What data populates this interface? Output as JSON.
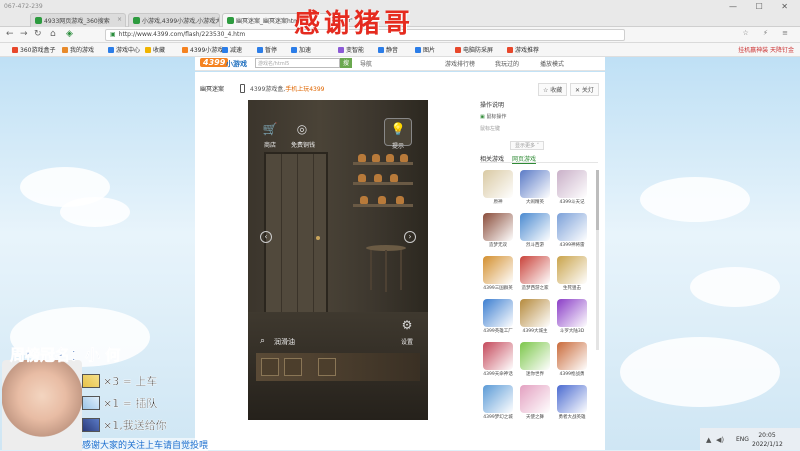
{
  "browser": {
    "ip_label": "067-472-239",
    "tabs": [
      {
        "title": "4933网页游戏_360搜索",
        "color": "#2d9b3f"
      },
      {
        "title": "小游戏,4399小游戏,小游戏大",
        "color": "#2d9b3f"
      },
      {
        "title": "幽冥迷案_幽冥迷案html5",
        "color": "#2d9b3f",
        "active": true
      }
    ],
    "new_tab": "+",
    "window_controls": "— ☐ ✕",
    "address": "http://www.4399.com/flash/223530_4.htm",
    "nav_right_icons": "☆ ⚡ ≡",
    "bookmarks": [
      {
        "label": "360游戏盒子",
        "color": "#e8472b"
      },
      {
        "label": "我的游戏",
        "color": "#e88a2b"
      },
      {
        "label": "游戏中心",
        "color": "#2b7de8"
      },
      {
        "label": "收藏",
        "color": "#f0b400"
      },
      {
        "label": "4399小游戏",
        "color": "#f58220"
      },
      {
        "label": "减速",
        "color": "#2b7de8"
      },
      {
        "label": "暂停",
        "color": "#2b7de8"
      },
      {
        "label": "加速",
        "color": "#2b7de8"
      },
      {
        "label": "变智能",
        "color": "#8c5ad6"
      },
      {
        "label": "静音",
        "color": "#2b7de8"
      },
      {
        "label": "图片",
        "color": "#2b7de8"
      },
      {
        "label": "电脑防采屏",
        "color": "#e8472b"
      },
      {
        "label": "游戏推荐",
        "color": "#e8472b"
      }
    ],
    "bookmark_right": "挂机赢神装 天降钉金"
  },
  "site": {
    "logo": "4399",
    "logo_suffix": "小游戏",
    "search_placeholder": "游戏名/html5",
    "search_button": "搜",
    "header_links": [
      "导航",
      "游戏排行榜",
      "我玩过的",
      "播放模式"
    ]
  },
  "game_page": {
    "title": "幽冥迷案",
    "note_prefix": "4399游戏盒,",
    "note_highlight": "手机上玩4399",
    "fav_button": "☆ 收藏",
    "close_button": "✕ 关灯"
  },
  "game": {
    "shop_label": "商店",
    "free_coins_label": "免费铜钱",
    "hint_label": "提示",
    "settings_label": "设置",
    "item_name": "润滑油",
    "left_arrow": "‹",
    "right_arrow": "›"
  },
  "sidebar": {
    "ops_title": "操作说明",
    "ops_line1": "鼠标操作",
    "ops_line2": "鼠标左键",
    "show_more": "显示更多 ˅",
    "tabs": [
      "相关游戏",
      "网页游戏"
    ],
    "active_tab": 1,
    "games": [
      {
        "name": "原神",
        "color": "#d9c9a3"
      },
      {
        "name": "大闹精英",
        "color": "#5a7ac6"
      },
      {
        "name": "4399斗天记",
        "color": "#c9b0c8"
      },
      {
        "name": "造梦无双",
        "color": "#8a4c3a"
      },
      {
        "name": "烈斗西游",
        "color": "#4a8ad0"
      },
      {
        "name": "4399神将雷",
        "color": "#7ba0d8"
      },
      {
        "name": "4399三国群英",
        "color": "#d38f2e"
      },
      {
        "name": "造梦西游之家",
        "color": "#c9423a"
      },
      {
        "name": "生死狙击",
        "color": "#c9a34a"
      },
      {
        "name": "4399英雄工厂",
        "color": "#3c7ed0"
      },
      {
        "name": "4399大城主",
        "color": "#b58a3c"
      },
      {
        "name": "斗罗大陆3D",
        "color": "#8a3cc6"
      },
      {
        "name": "4399天命神话",
        "color": "#c4485a"
      },
      {
        "name": "迷你世界",
        "color": "#7cc64a"
      },
      {
        "name": "4399枪战勇",
        "color": "#c96a3a"
      },
      {
        "name": "4399梦幻之城",
        "color": "#5a9ad6"
      },
      {
        "name": "天使之舞",
        "color": "#e3a0c0"
      },
      {
        "name": "勇者大战英雄",
        "color": "#4a6ad0"
      }
    ]
  },
  "overlay": {
    "banner": "感谢猪哥",
    "champion": "周榜冠名：小  何",
    "gift_lines": [
      "×3 = 上车",
      "×1 = 插队",
      "×1,我送给你"
    ],
    "thanks": "感谢大家的关注上车请自觉投喂"
  },
  "tray": {
    "lang": "ENG",
    "time": "20:05",
    "date": "2022/1/12"
  }
}
